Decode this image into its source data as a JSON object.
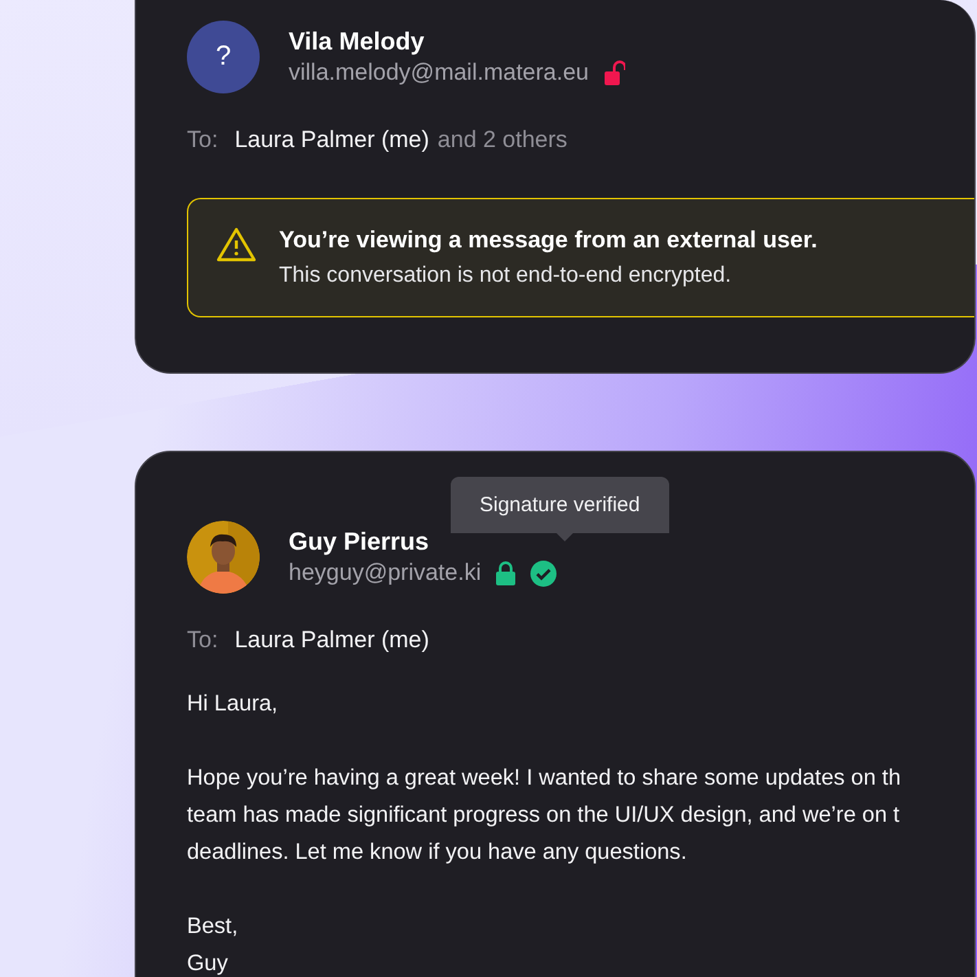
{
  "messages": [
    {
      "sender": {
        "name": "Vila Melody",
        "email": "villa.melody@mail.matera.eu",
        "avatar": {
          "kind": "initial",
          "text": "?"
        },
        "encrypted": false
      },
      "to": {
        "label": "To:",
        "recipient": "Laura Palmer (me)",
        "others": "and 2 others"
      },
      "alert": {
        "title": "You’re viewing a message from an external user.",
        "text": "This conversation is not end-to-end encrypted."
      }
    },
    {
      "sender": {
        "name": "Guy Pierrus",
        "email": "heyguy@private.ki",
        "encrypted": true,
        "signature_verified": true,
        "tooltip": "Signature verified"
      },
      "to": {
        "label": "To:",
        "recipient": "Laura Palmer (me)"
      },
      "body": [
        [
          "Hi Laura,"
        ],
        [
          "Hope you’re having a great week! I wanted to share some updates on th",
          "team has made significant progress on the UI/UX design, and we’re on t",
          "deadlines. Let me know if you have any questions."
        ],
        [
          "Best,",
          "Guy"
        ]
      ]
    }
  ]
}
